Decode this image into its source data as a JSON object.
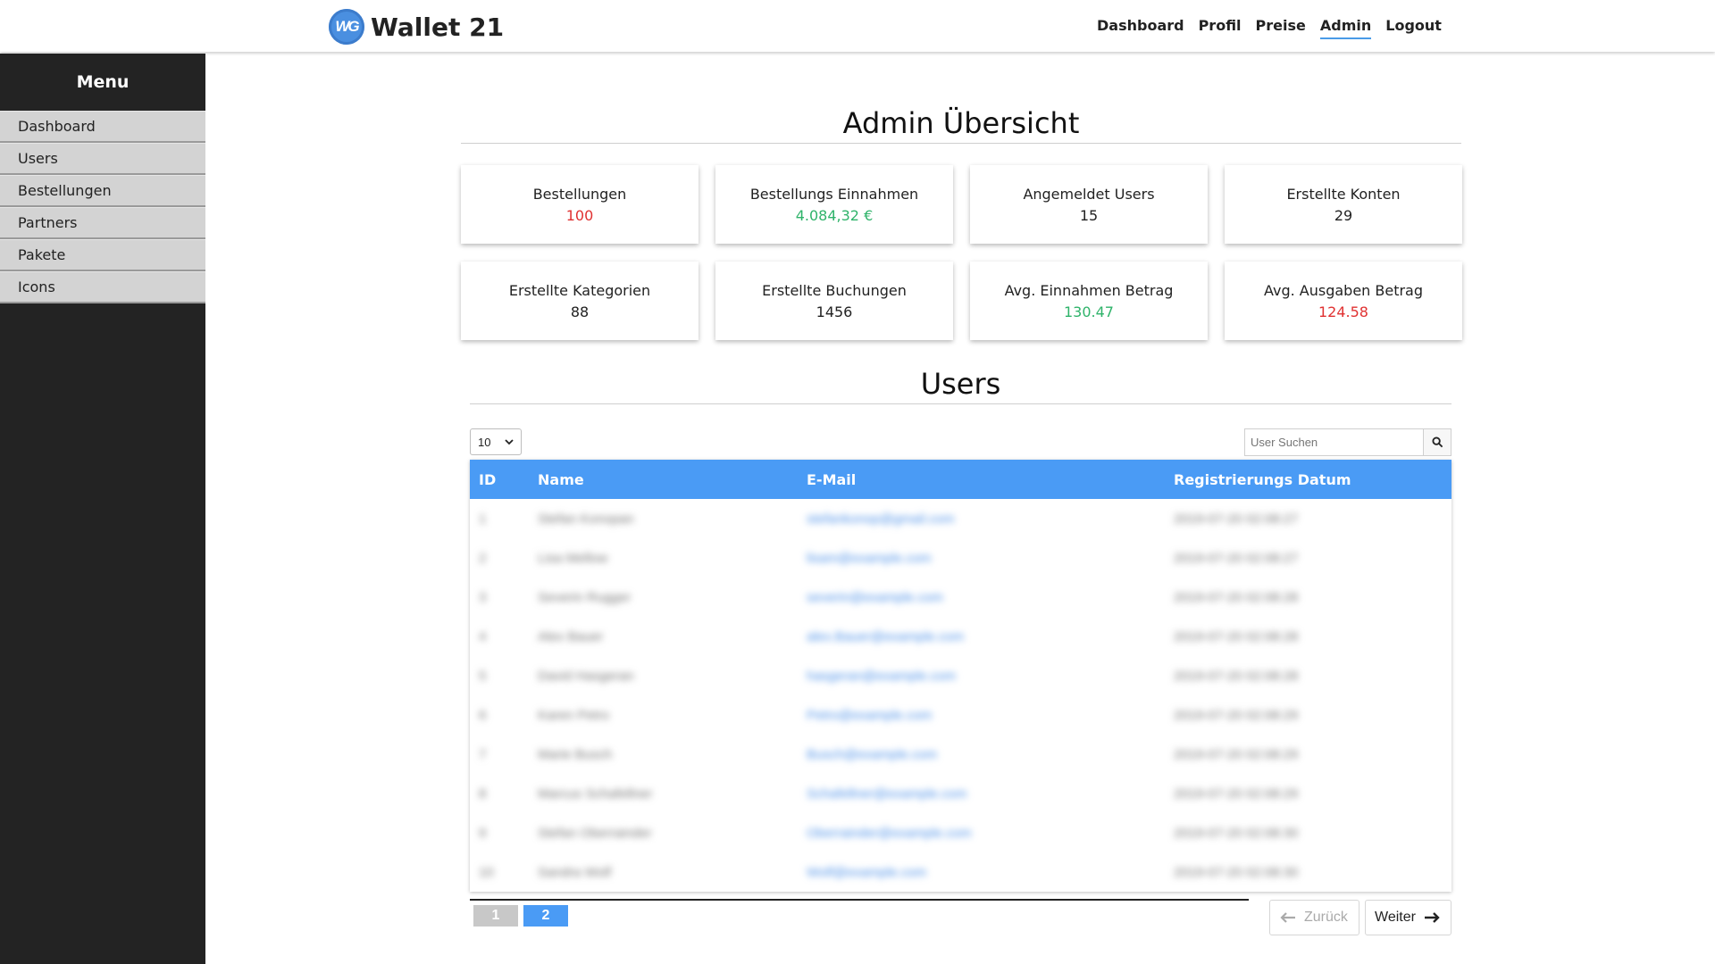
{
  "brand": {
    "logo_text": "WG",
    "name": "Wallet 21"
  },
  "nav": [
    {
      "label": "Dashboard",
      "active": false
    },
    {
      "label": "Profil",
      "active": false
    },
    {
      "label": "Preise",
      "active": false
    },
    {
      "label": "Admin",
      "active": true
    },
    {
      "label": "Logout",
      "active": false
    }
  ],
  "sidebar": {
    "title": "Menu",
    "items": [
      "Dashboard",
      "Users",
      "Bestellungen",
      "Partners",
      "Pakete",
      "Icons"
    ]
  },
  "overview": {
    "title": "Admin Übersicht",
    "cards": [
      {
        "label": "Bestellungen",
        "value": "100",
        "tone": "red"
      },
      {
        "label": "Bestellungs Einnahmen",
        "value": "4.084,32 €",
        "tone": "green"
      },
      {
        "label": "Angemeldet Users",
        "value": "15",
        "tone": "dark"
      },
      {
        "label": "Erstellte Konten",
        "value": "29",
        "tone": "dark"
      },
      {
        "label": "Erstellte Kategorien",
        "value": "88",
        "tone": "dark"
      },
      {
        "label": "Erstellte Buchungen",
        "value": "1456",
        "tone": "dark"
      },
      {
        "label": "Avg. Einnahmen Betrag",
        "value": "130.47",
        "tone": "green"
      },
      {
        "label": "Avg. Ausgaben Betrag",
        "value": "124.58",
        "tone": "red"
      }
    ]
  },
  "users": {
    "title": "Users",
    "per_page": "10",
    "search_placeholder": "User Suchen",
    "columns": [
      "ID",
      "Name",
      "E-Mail",
      "Registrierungs Datum"
    ],
    "rows": [
      {
        "id": "1",
        "name": "Stefan Konopan",
        "email": "stefankonop@gmail.com",
        "date": "2019-07-20 02:08:27"
      },
      {
        "id": "2",
        "name": "Lisa Mellow",
        "email": "lisam@example.com",
        "date": "2019-07-20 02:08:27"
      },
      {
        "id": "3",
        "name": "Severin Rugger",
        "email": "severin@example.com",
        "date": "2019-07-20 02:08:28"
      },
      {
        "id": "4",
        "name": "Alex Bauer",
        "email": "alex.Bauer@example.com",
        "date": "2019-07-20 02:08:28"
      },
      {
        "id": "5",
        "name": "David Hasgeran",
        "email": "hasgeran@example.com",
        "date": "2019-07-20 02:08:28"
      },
      {
        "id": "6",
        "name": "Karen Petro",
        "email": "Petro@example.com",
        "date": "2019-07-20 02:08:29"
      },
      {
        "id": "7",
        "name": "Marie Busch",
        "email": "Busch@example.com",
        "date": "2019-07-20 02:08:29"
      },
      {
        "id": "8",
        "name": "Marcus Schafellner",
        "email": "Schafellner@example.com",
        "date": "2019-07-20 02:08:29"
      },
      {
        "id": "9",
        "name": "Stefan Oberrainder",
        "email": "Oberrainder@example.com",
        "date": "2019-07-20 02:08:30"
      },
      {
        "id": "10",
        "name": "Sandra Wolf",
        "email": "Wolf@example.com",
        "date": "2019-07-20 02:08:30"
      }
    ],
    "pages": [
      "1",
      "2"
    ],
    "current_page": "2",
    "back_label": "Zurück",
    "next_label": "Weiter"
  },
  "colors": {
    "accent": "#4a9bf5",
    "sidebar_bg": "#232323",
    "red": "#e03131",
    "green": "#2fb36a"
  }
}
